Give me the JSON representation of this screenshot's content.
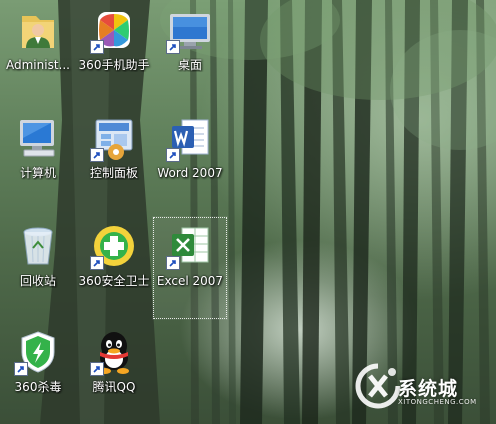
{
  "desktop": {
    "icons": [
      {
        "label": "Administ...",
        "icon": "user-folder-icon",
        "shortcut": false
      },
      {
        "label": "360手机助手",
        "icon": "360-phone-assistant-icon",
        "shortcut": true
      },
      {
        "label": "桌面",
        "icon": "desktop-icon",
        "shortcut": true
      },
      {
        "label": "计算机",
        "icon": "computer-icon",
        "shortcut": false
      },
      {
        "label": "控制面板",
        "icon": "control-panel-icon",
        "shortcut": true
      },
      {
        "label": "Word 2007",
        "icon": "word-icon",
        "shortcut": true
      },
      {
        "label": "回收站",
        "icon": "recycle-bin-icon",
        "shortcut": false
      },
      {
        "label": "360安全卫士",
        "icon": "360-security-icon",
        "shortcut": true
      },
      {
        "label": "Excel 2007",
        "icon": "excel-icon",
        "shortcut": true,
        "selected": true
      },
      {
        "label": "360杀毒",
        "icon": "360-antivirus-icon",
        "shortcut": true
      },
      {
        "label": "腾讯QQ",
        "icon": "qq-icon",
        "shortcut": true
      }
    ]
  },
  "watermark": {
    "name": "系统城",
    "url": "XITONGCHENG.COM"
  },
  "colors": {
    "forest_dark": "#3b4f38",
    "forest_light": "#d7e6d1",
    "label_text": "#ffffff",
    "word_blue": "#2b5fb3",
    "excel_green": "#2f8a3b",
    "qq_black": "#111111",
    "360_green": "#34b24a"
  }
}
